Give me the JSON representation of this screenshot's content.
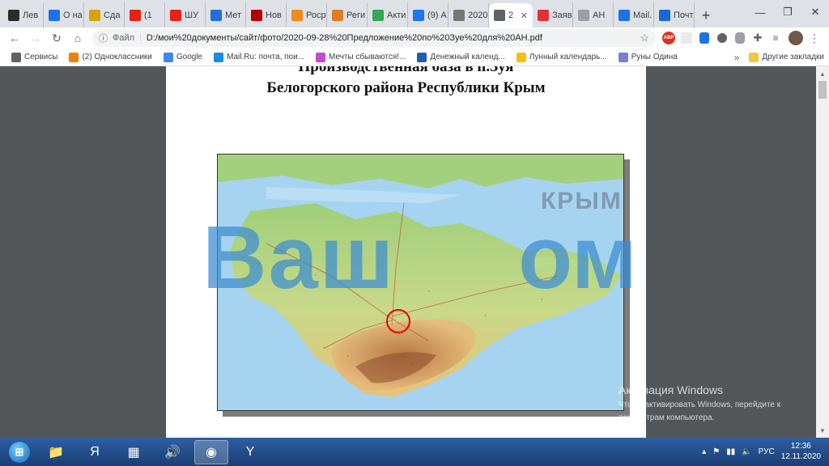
{
  "tabs": [
    {
      "label": "Лев",
      "icon": "book-icon",
      "color": "#2b2b2b"
    },
    {
      "label": "О на",
      "icon": "globe-icon",
      "color": "#1a73e8"
    },
    {
      "label": "Сда",
      "icon": "b-icon",
      "color": "#d6a400"
    },
    {
      "label": "(1",
      "icon": "youtube-icon",
      "color": "#e62117"
    },
    {
      "label": "ШУ",
      "icon": "youtube-icon",
      "color": "#e62117"
    },
    {
      "label": "Мет",
      "icon": "meteo-icon",
      "color": "#1e6fd9"
    },
    {
      "label": "Нов",
      "icon": "news-icon",
      "color": "#b00000"
    },
    {
      "label": "Роср",
      "icon": "rosreestr-icon",
      "color": "#f08a1c"
    },
    {
      "label": "Реги",
      "icon": "reg-icon",
      "color": "#e27b24"
    },
    {
      "label": "Акти",
      "icon": "play-icon",
      "color": "#34a853"
    },
    {
      "label": "(9) А",
      "icon": "facebook-icon",
      "color": "#1877f2"
    },
    {
      "label": "2020",
      "icon": "globe-icon",
      "color": "#777777"
    },
    {
      "label": "2",
      "icon": "globe-icon",
      "color": "#5f6368",
      "active": true
    },
    {
      "label": "Заяв",
      "icon": "flag-icon",
      "color": "#d33"
    },
    {
      "label": "АН",
      "icon": "triangle-icon",
      "color": "#9aa0a6"
    },
    {
      "label": "Mail.",
      "icon": "mail-icon",
      "color": "#1a73e8"
    },
    {
      "label": "Почт",
      "icon": "envelope-icon",
      "color": "#1967d2"
    }
  ],
  "toolbar": {
    "scheme": "Файл",
    "url": "D:/мои%20документы/сайт/фото/2020-09-28%20Предложение%20по%20Зуе%20для%20АН.pdf",
    "ext_abp": "ABP"
  },
  "bookmarks": {
    "items": [
      {
        "label": "Сервисы",
        "icon": "apps-icon",
        "color": "#5f6368"
      },
      {
        "label": "(2) Одноклассники",
        "icon": "ok-icon",
        "color": "#ee8208"
      },
      {
        "label": "Google",
        "icon": "google-icon",
        "color": "#4285f4"
      },
      {
        "label": "Mail.Ru: почта, пои...",
        "icon": "mailru-icon",
        "color": "#168de2"
      },
      {
        "label": "Мечты сбываются!...",
        "icon": "dream-icon",
        "color": "#c04bd1"
      },
      {
        "label": "Денежный календ...",
        "icon": "money-calendar-icon",
        "color": "#1e5db5"
      },
      {
        "label": "Лунный календарь...",
        "icon": "moon-icon",
        "color": "#f4c20d"
      },
      {
        "label": "Руны Одина",
        "icon": "runes-icon",
        "color": "#7b7fd6"
      }
    ],
    "other": "Другие закладки"
  },
  "pdf": {
    "title_line1": "Производственная база в п.Зуя",
    "title_line2": "Белогорского района Республики Крым"
  },
  "watermark": {
    "part1": "Ваш",
    "part2": "ом",
    "krym": "КРЫМ"
  },
  "activation": {
    "line1": "Активация Windows",
    "line2": "Чтобы активировать Windows, перейдите к",
    "line3": "параметрам компьютера."
  },
  "taskbar": {
    "apps": [
      {
        "name": "explorer",
        "icon": "folder-icon",
        "glyph": "📁"
      },
      {
        "name": "yandex",
        "icon": "yandex-icon",
        "glyph": "Я"
      },
      {
        "name": "calculator",
        "icon": "calculator-icon",
        "glyph": "▦"
      },
      {
        "name": "media",
        "icon": "speaker-icon",
        "glyph": "🔊"
      },
      {
        "name": "chrome",
        "icon": "chrome-icon",
        "glyph": "◉",
        "active": true
      },
      {
        "name": "yandex-browser",
        "icon": "yandex-browser-icon",
        "glyph": "Y"
      }
    ],
    "lang": "РУС",
    "time": "12:36",
    "date": "12.11.2020"
  }
}
